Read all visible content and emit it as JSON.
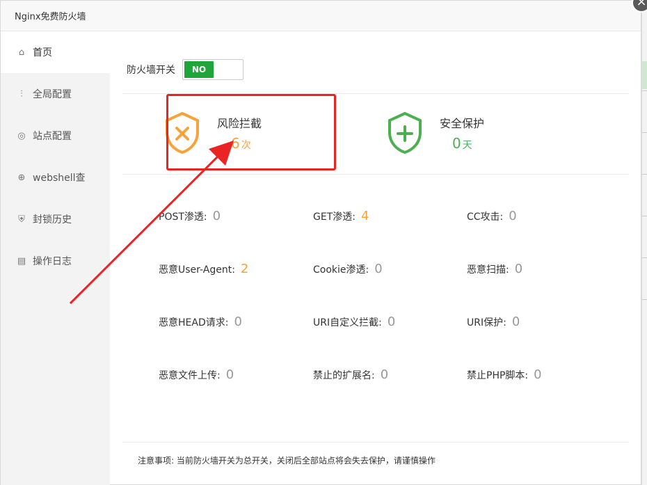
{
  "window": {
    "title": "Nginx免费防火墙",
    "close_glyph": "×"
  },
  "sidebar": {
    "items": [
      {
        "label": "首页",
        "icon": "home-icon",
        "glyph": "⌂"
      },
      {
        "label": "全局配置",
        "icon": "sliders-icon",
        "glyph": "⫶"
      },
      {
        "label": "站点配置",
        "icon": "globe-icon",
        "glyph": "◎"
      },
      {
        "label": "webshell查",
        "icon": "target-icon",
        "glyph": "⊕"
      },
      {
        "label": "封锁历史",
        "icon": "lock-icon",
        "glyph": "⛨"
      },
      {
        "label": "操作日志",
        "icon": "clipboard-icon",
        "glyph": "▤"
      }
    ]
  },
  "firewall": {
    "switch_label": "防火墙开关",
    "toggle_text": "NO",
    "toggle_color": "#20a53a"
  },
  "summary": {
    "risk": {
      "title": "风险拦截",
      "count": "6",
      "unit": "次",
      "color": "#f7a23b",
      "icon": "shield-x-icon"
    },
    "safe": {
      "title": "安全保护",
      "count": "0",
      "unit": "天",
      "color": "#4caf50",
      "icon": "shield-plus-icon"
    }
  },
  "stats": [
    {
      "label": "POST渗透:",
      "value": "0",
      "highlight": false
    },
    {
      "label": "GET渗透:",
      "value": "4",
      "highlight": true
    },
    {
      "label": "CC攻击:",
      "value": "0",
      "highlight": false
    },
    {
      "label": "恶意User-Agent:",
      "value": "2",
      "highlight": true
    },
    {
      "label": "Cookie渗透:",
      "value": "0",
      "highlight": false
    },
    {
      "label": "恶意扫描:",
      "value": "0",
      "highlight": false
    },
    {
      "label": "恶意HEAD请求:",
      "value": "0",
      "highlight": false
    },
    {
      "label": "URI自定义拦截:",
      "value": "0",
      "highlight": false
    },
    {
      "label": "URI保护:",
      "value": "0",
      "highlight": false
    },
    {
      "label": "恶意文件上传:",
      "value": "0",
      "highlight": false
    },
    {
      "label": "禁止的扩展名:",
      "value": "0",
      "highlight": false
    },
    {
      "label": "禁止PHP脚本:",
      "value": "0",
      "highlight": false
    }
  ],
  "notice": "注意事项: 当前防火墙开关为总开关，关闭后全部站点将会失去保护，请谨慎操作",
  "annotation": {
    "box_color": "#ea2323",
    "arrow_color": "#ea2323"
  }
}
